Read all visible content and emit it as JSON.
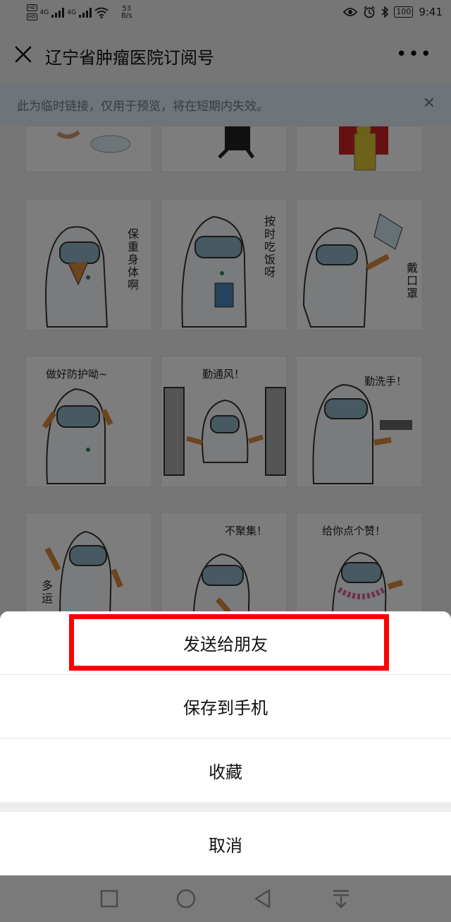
{
  "status_bar": {
    "hd_badge": "HD",
    "signal_label": "4G",
    "net_speed_value": "53",
    "net_speed_unit": "B/s",
    "battery": "100",
    "time": "9:41"
  },
  "header": {
    "title": "辽宁省肿瘤医院订阅号"
  },
  "notice": {
    "text": "此为临时链接，仅用于预览，将在短期内失效。"
  },
  "stickers": [
    {
      "caption": "保重身体啊"
    },
    {
      "caption": "按时吃饭呀"
    },
    {
      "caption": "戴口罩"
    },
    {
      "caption": "做好防护呦~"
    },
    {
      "caption": "勤通风！"
    },
    {
      "caption": "勤洗手！"
    },
    {
      "caption": "多运"
    },
    {
      "caption": "不聚集！"
    },
    {
      "caption": "给你点个赞！"
    }
  ],
  "action_sheet": {
    "send_to_friend": "发送给朋友",
    "save_to_phone": "保存到手机",
    "favorite": "收藏",
    "cancel": "取消"
  },
  "colors": {
    "highlight": "#ff0000",
    "overlay": "rgba(0,0,0,0.5)",
    "notice_bg": "#dfe8f0"
  }
}
